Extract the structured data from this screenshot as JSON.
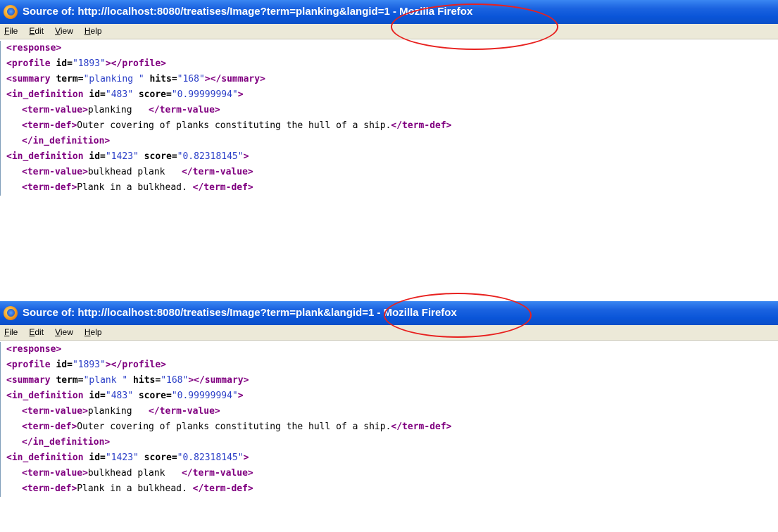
{
  "windows": [
    {
      "title": "Source of: http://localhost:8080/treatises/Image?term=planking&langid=1 - Mozilla Firefox",
      "menu": [
        "File",
        "Edit",
        "View",
        "Help"
      ],
      "source": {
        "response_tag": "<response>",
        "profile": {
          "open": "<profile",
          "id_attr": " id=",
          "id_val": "\"1893\"",
          "close": "></profile>"
        },
        "summary": {
          "open": "<summary",
          "term_attr": " term=",
          "term_val": "\"planking \"",
          "hits_attr": " hits=",
          "hits_val": "\"168\"",
          "close": "></summary>"
        },
        "def1": {
          "open": "<in_definition",
          "id_attr": " id=",
          "id_val": "\"483\"",
          "score_attr": " score=",
          "score_val": "\"0.99999994\"",
          "gt": ">",
          "tv_open": "<term-value>",
          "tv_text": "planking   ",
          "tv_close": "</term-value>",
          "td_open": "<term-def>",
          "td_text": "Outer covering of planks constituting the hull of a ship.",
          "td_close": "</term-def>",
          "end": "</in_definition>"
        },
        "def2": {
          "open": "<in_definition",
          "id_attr": " id=",
          "id_val": "\"1423\"",
          "score_attr": " score=",
          "score_val": "\"0.82318145\"",
          "gt": ">",
          "tv_open": "<term-value>",
          "tv_text": "bulkhead plank   ",
          "tv_close": "</term-value>",
          "td_open": "<term-def>",
          "td_text": "Plank in a bulkhead. ",
          "td_close": "</term-def>"
        }
      }
    },
    {
      "title": "Source of: http://localhost:8080/treatises/Image?term=plank&langid=1 - Mozilla Firefox",
      "menu": [
        "File",
        "Edit",
        "View",
        "Help"
      ],
      "source": {
        "response_tag": "<response>",
        "profile": {
          "open": "<profile",
          "id_attr": " id=",
          "id_val": "\"1893\"",
          "close": "></profile>"
        },
        "summary": {
          "open": "<summary",
          "term_attr": " term=",
          "term_val": "\"plank \"",
          "hits_attr": " hits=",
          "hits_val": "\"168\"",
          "close": "></summary>"
        },
        "def1": {
          "open": "<in_definition",
          "id_attr": " id=",
          "id_val": "\"483\"",
          "score_attr": " score=",
          "score_val": "\"0.99999994\"",
          "gt": ">",
          "tv_open": "<term-value>",
          "tv_text": "planking   ",
          "tv_close": "</term-value>",
          "td_open": "<term-def>",
          "td_text": "Outer covering of planks constituting the hull of a ship.",
          "td_close": "</term-def>",
          "end": "</in_definition>"
        },
        "def2": {
          "open": "<in_definition",
          "id_attr": " id=",
          "id_val": "\"1423\"",
          "score_attr": " score=",
          "score_val": "\"0.82318145\"",
          "gt": ">",
          "tv_open": "<term-value>",
          "tv_text": "bulkhead plank   ",
          "tv_close": "</term-value>",
          "td_open": "<term-def>",
          "td_text": "Plank in a bulkhead. ",
          "td_close": "</term-def>"
        }
      }
    }
  ],
  "colors": {
    "titlebar": "#0a55d8",
    "tag": "#800080",
    "value": "#2a3ec7",
    "highlight": "#e8211f"
  }
}
